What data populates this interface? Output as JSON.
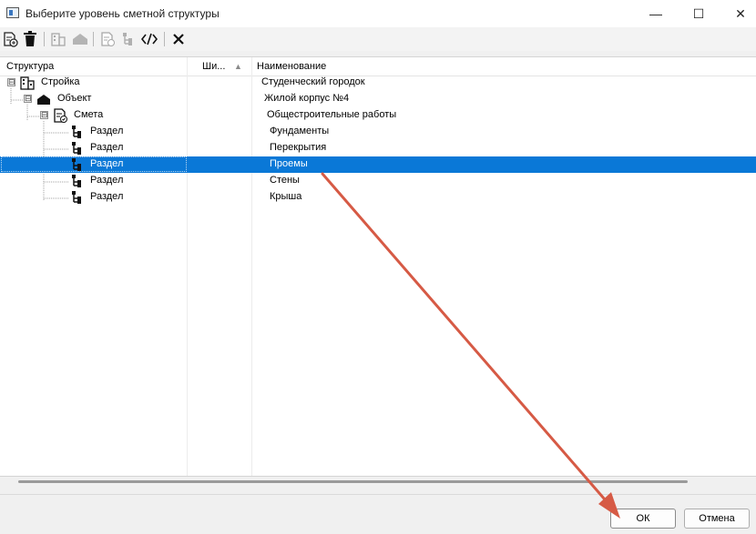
{
  "window": {
    "title": "Выберите уровень сметной структуры",
    "minimize_glyph": "—",
    "maximize_glyph": "☐",
    "close_glyph": "✕"
  },
  "toolbar": {
    "buttons": [
      {
        "icon": "new-document-icon",
        "enabled": true
      },
      {
        "icon": "trash-icon",
        "enabled": true
      },
      {
        "icon": "building-icon",
        "enabled": false
      },
      {
        "icon": "house-icon",
        "enabled": false
      },
      {
        "icon": "estimate-document-icon",
        "enabled": false
      },
      {
        "icon": "section-tree-icon",
        "enabled": false
      },
      {
        "icon": "code-brackets-icon",
        "enabled": true
      },
      {
        "icon": "close-icon",
        "enabled": true
      }
    ]
  },
  "columns": {
    "structure": "Структура",
    "code": "Ши...",
    "code_sort": "▲",
    "name": "Наименование"
  },
  "rows": [
    {
      "label": "Стройка",
      "name": "Студенческий городок",
      "icon": "building-icon",
      "expander": "⊟",
      "selected": false
    },
    {
      "label": "Объект",
      "name": "Жилой корпус №4",
      "icon": "house-icon",
      "expander": "⊟",
      "selected": false
    },
    {
      "label": "Смета",
      "name": "Общестроительные работы",
      "icon": "estimate-document-icon",
      "expander": "⊟",
      "selected": false
    },
    {
      "label": "Раздел",
      "name": "Фундаменты",
      "icon": "section-tree-icon",
      "selected": false
    },
    {
      "label": "Раздел",
      "name": "Перекрытия",
      "icon": "section-tree-icon",
      "selected": false
    },
    {
      "label": "Раздел",
      "name": "Проемы",
      "icon": "section-tree-icon",
      "selected": true
    },
    {
      "label": "Раздел",
      "name": "Стены",
      "icon": "section-tree-icon",
      "selected": false
    },
    {
      "label": "Раздел",
      "name": "Крыша",
      "icon": "section-tree-icon",
      "selected": false
    }
  ],
  "buttons": {
    "ok": "ОК",
    "cancel": "Отмена"
  },
  "annotation": {
    "arrow_color": "#d65a45"
  },
  "colors": {
    "selection": "#0a78d7"
  }
}
